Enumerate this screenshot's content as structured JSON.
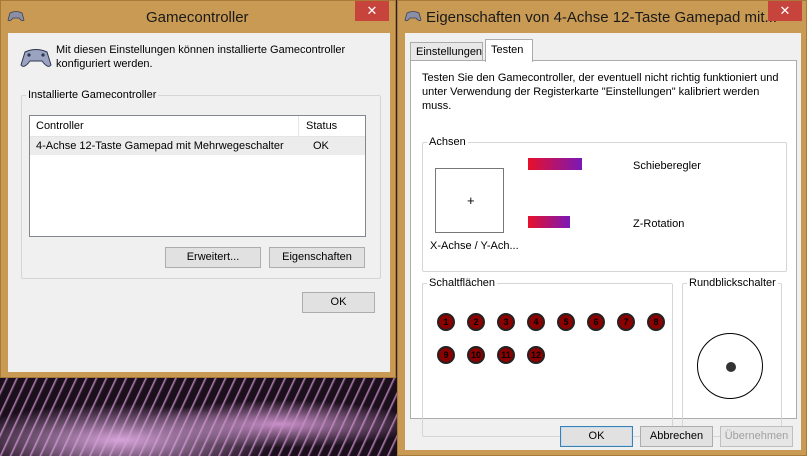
{
  "left_window": {
    "title": "Gamecontroller",
    "close_glyph": "✕",
    "intro": "Mit diesen Einstellungen können installierte Gamecontroller konfiguriert werden.",
    "group_label": "Installierte Gamecontroller",
    "list": {
      "columns": [
        "Controller",
        "Status"
      ],
      "rows": [
        {
          "controller": "4-Achse 12-Taste Gamepad mit Mehrwegeschalter",
          "status": "OK"
        }
      ]
    },
    "advanced_label": "Erweitert...",
    "properties_label": "Eigenschaften",
    "ok_label": "OK"
  },
  "right_window": {
    "title": "Eigenschaften von 4-Achse 12-Taste Gamepad mit...",
    "close_glyph": "✕",
    "tabs": [
      "Einstellungen",
      "Testen"
    ],
    "active_tab": "Testen",
    "description": "Testen Sie den Gamecontroller, der eventuell nicht richtig funktioniert und unter Verwendung der Registerkarte \"Einstellungen\" kalibriert werden muss.",
    "axes": {
      "group_label": "Achsen",
      "xy_label": "X-Achse / Y-Ach...",
      "crosshair": "+",
      "slider_label": "Schieberegler",
      "zrot_label": "Z-Rotation",
      "slider_level_pct": 100,
      "zrot_level_pct": 78
    },
    "buttons_group_label": "Schaltflächen",
    "buttons": [
      "1",
      "2",
      "3",
      "4",
      "5",
      "6",
      "7",
      "8",
      "9",
      "10",
      "11",
      "12"
    ],
    "hat_group_label": "Rundblickschalter",
    "ok_label": "OK",
    "cancel_label": "Abbrechen",
    "apply_label": "Übernehmen"
  },
  "colors": {
    "frame": "#c99a53",
    "close_button": "#c7443c",
    "bar_start": "#e8102a",
    "bar_end": "#7a18b8",
    "pad_button": "#8b0000"
  },
  "icons": {
    "app_icon": "gamepad-icon",
    "intro_icon": "gamepad-icon"
  }
}
